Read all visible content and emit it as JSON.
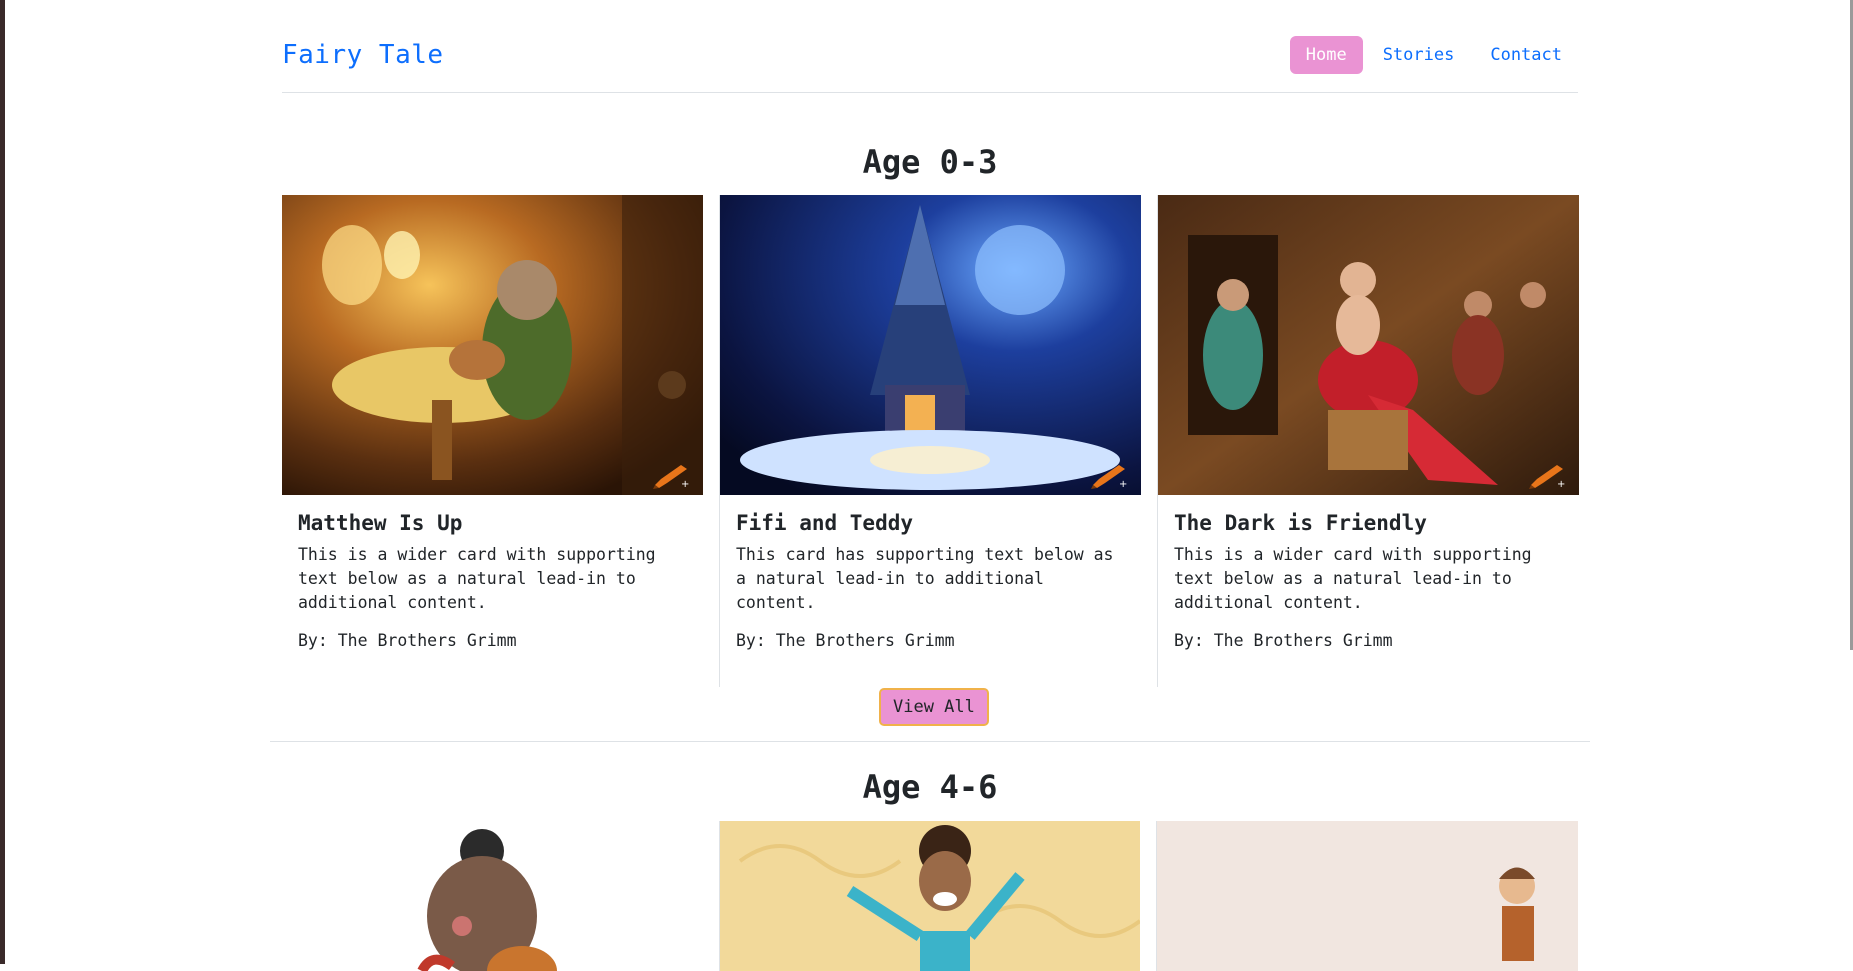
{
  "header": {
    "brand": "Fairy Tale",
    "nav": [
      {
        "label": "Home",
        "active": true
      },
      {
        "label": "Stories",
        "active": false
      },
      {
        "label": "Contact",
        "active": false
      }
    ]
  },
  "sections": [
    {
      "title": "Age 0-3",
      "cards": [
        {
          "title": "Matthew Is Up",
          "text": "This is a wider card with supporting text below as a natural lead-in to additional content.",
          "author": "By: The Brothers Grimm"
        },
        {
          "title": "Fifi and Teddy",
          "text": "This card has supporting text below as a natural lead-in to additional content.",
          "author": "By: The Brothers Grimm"
        },
        {
          "title": "The Dark is Friendly",
          "text": "This is a wider card with supporting text below as a natural lead-in to additional content.",
          "author": "By: The Brothers Grimm"
        }
      ],
      "button": "View All"
    },
    {
      "title": "Age 4-6"
    }
  ],
  "colors": {
    "accent": "#ea93d3",
    "link": "#0d6efd",
    "button_border": "#f0b24a"
  }
}
